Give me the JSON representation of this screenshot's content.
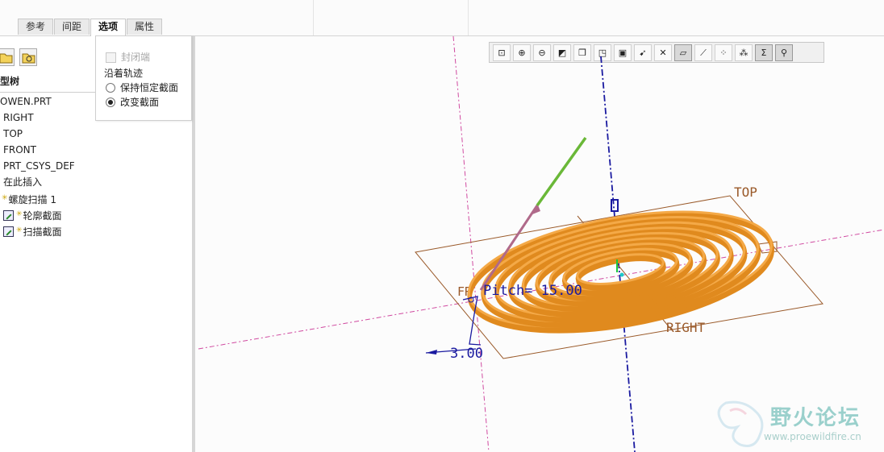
{
  "tabs": [
    "参考",
    "间距",
    "选项",
    "属性"
  ],
  "active_tab": "选项",
  "options_panel": {
    "closed_ends_label": "封闭端",
    "along_trajectory_label": "沿着轨迹",
    "keep_constant_section": "保持恒定截面",
    "vary_section": "改变截面",
    "selected_option": "改变截面"
  },
  "model_tree": {
    "header": "型树",
    "items": [
      {
        "label": "OWEN.PRT",
        "icon": "part-icon"
      },
      {
        "label": "RIGHT",
        "icon": "datum-plane-icon"
      },
      {
        "label": "TOP",
        "icon": "datum-plane-icon"
      },
      {
        "label": "FRONT",
        "icon": "datum-plane-icon"
      },
      {
        "label": "PRT_CSYS_DEF",
        "icon": "csys-icon"
      },
      {
        "label": "在此插入",
        "icon": "insert-here-icon"
      },
      {
        "label": "螺旋扫描 1",
        "icon": "helical-sweep-icon"
      },
      {
        "label": "轮廓截面",
        "icon": "sketch-icon"
      },
      {
        "label": "扫描截面",
        "icon": "sketch-icon"
      }
    ]
  },
  "view_toolbar": [
    "refit-icon",
    "zoom-in-icon",
    "zoom-out-icon",
    "repaint-icon",
    "saved-views-icon",
    "orientation-icon",
    "display-style-icon",
    "named-view-icon",
    "spin-center-icon",
    "plane-display-icon",
    "axis-display-icon",
    "point-display-icon",
    "csys-display-icon",
    "annotation-display-icon",
    "datum-display-icon"
  ],
  "canvas_labels": {
    "top_plane": "TOP",
    "right_plane": "RIGHT",
    "front_plane": "FR",
    "pitch": "Pitch= 15.00",
    "dimension": "3.00"
  },
  "colors": {
    "coil": "#e08a1e",
    "datum_plane": "#9a5a2a",
    "axis": "#1a1aa0",
    "csys_dashed": "#d04aa0",
    "arrow_green": "#6ab838"
  },
  "watermark": {
    "text": "野火论坛",
    "url": "www.proewildfire.cn"
  }
}
